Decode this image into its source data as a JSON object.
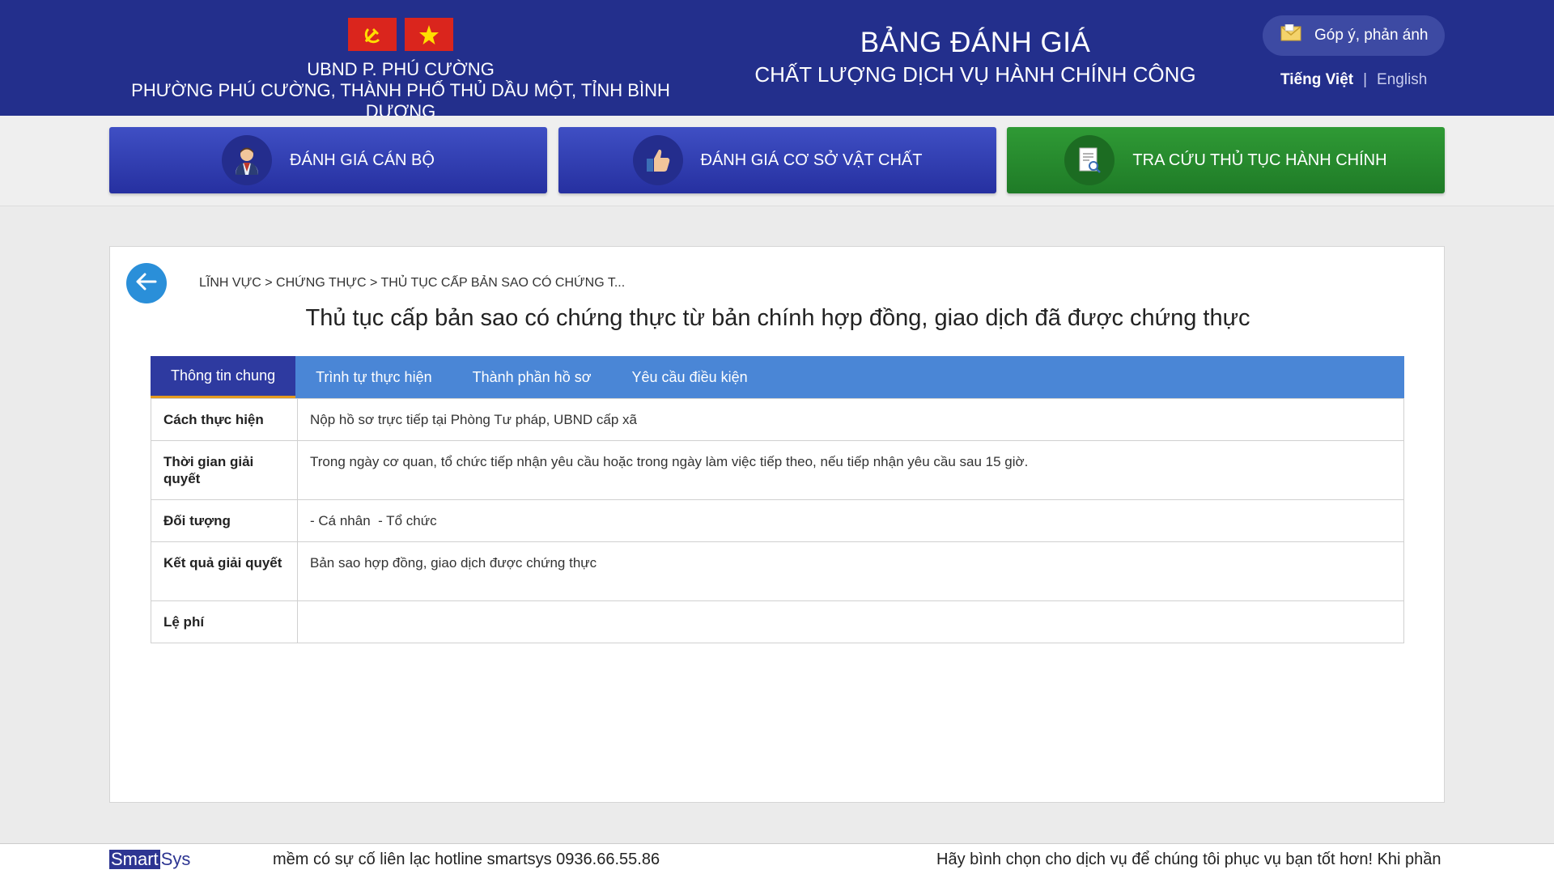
{
  "header": {
    "org_line1": "UBND P. PHÚ CƯỜNG",
    "org_line2": "PHƯỜNG PHÚ CƯỜNG, THÀNH PHỐ THỦ DẦU MỘT, TỈNH BÌNH DƯƠNG",
    "title_main": "BẢNG ĐÁNH GIÁ",
    "title_sub": "CHẤT LƯỢNG DỊCH VỤ HÀNH CHÍNH CÔNG",
    "feedback_label": "Góp ý, phản ánh",
    "lang_vi": "Tiếng Việt",
    "lang_sep": "|",
    "lang_en": "English",
    "icons": {
      "party_flag": "hammer-sickle-flag-icon",
      "national_flag": "vietnam-flag-icon",
      "feedback": "envelope-icon"
    }
  },
  "nav": {
    "staff_label": "ĐÁNH GIÁ CÁN BỘ",
    "facility_label": "ĐÁNH GIÁ CƠ SỞ VẬT CHẤT",
    "lookup_label": "TRA CỨU THỦ TỤC HÀNH CHÍNH",
    "icons": {
      "staff": "officer-icon",
      "facility": "thumbs-up-icon",
      "lookup": "document-search-icon"
    }
  },
  "main": {
    "breadcrumb": "LĨNH VỰC > CHỨNG THỰC > THỦ TỤC CẤP BẢN SAO CÓ CHỨNG T...",
    "title": "Thủ tục cấp bản sao có chứng thực từ bản chính hợp đồng, giao dịch đã được chứng thực",
    "tabs": [
      {
        "label": "Thông tin chung",
        "active": true
      },
      {
        "label": "Trình tự thực hiện",
        "active": false
      },
      {
        "label": "Thành phần hồ sơ",
        "active": false
      },
      {
        "label": "Yêu cầu điều kiện",
        "active": false
      }
    ],
    "rows": [
      {
        "label": "Cách thực hiện",
        "value": "Nộp hồ sơ trực tiếp tại Phòng Tư pháp, UBND cấp xã"
      },
      {
        "label": "Thời gian giải quyết",
        "value": "Trong ngày cơ quan, tổ chức tiếp nhận yêu cầu hoặc trong ngày làm việc tiếp theo, nếu tiếp nhận yêu cầu sau 15 giờ."
      },
      {
        "label": "Đối tượng",
        "value": "- Cá nhân  - Tổ chức"
      },
      {
        "label": "Kết quả giải quyết",
        "value": "Bản sao hợp đồng, giao dịch được chứng thực"
      },
      {
        "label": "Lệ phí",
        "value": ""
      }
    ]
  },
  "footer": {
    "brand_part1": "Smart",
    "brand_part2": "Sys",
    "ticker_left": "mềm có sự cố liên lạc hotline smartsys 0936.66.55.86",
    "ticker_right": "Hãy bình chọn cho dịch vụ để chúng tôi phục vụ bạn tốt hơn! Khi phần mềm có sự cố liên lạc hotline smartsys 0936.66.55.86"
  },
  "colors": {
    "header_bg": "#232f8c",
    "nav_blue": "#2e3aa8",
    "nav_green": "#238a2b",
    "tab_bar": "#4a86d6",
    "tab_active": "#2e3aa0",
    "back_button": "#2a8fd9"
  }
}
